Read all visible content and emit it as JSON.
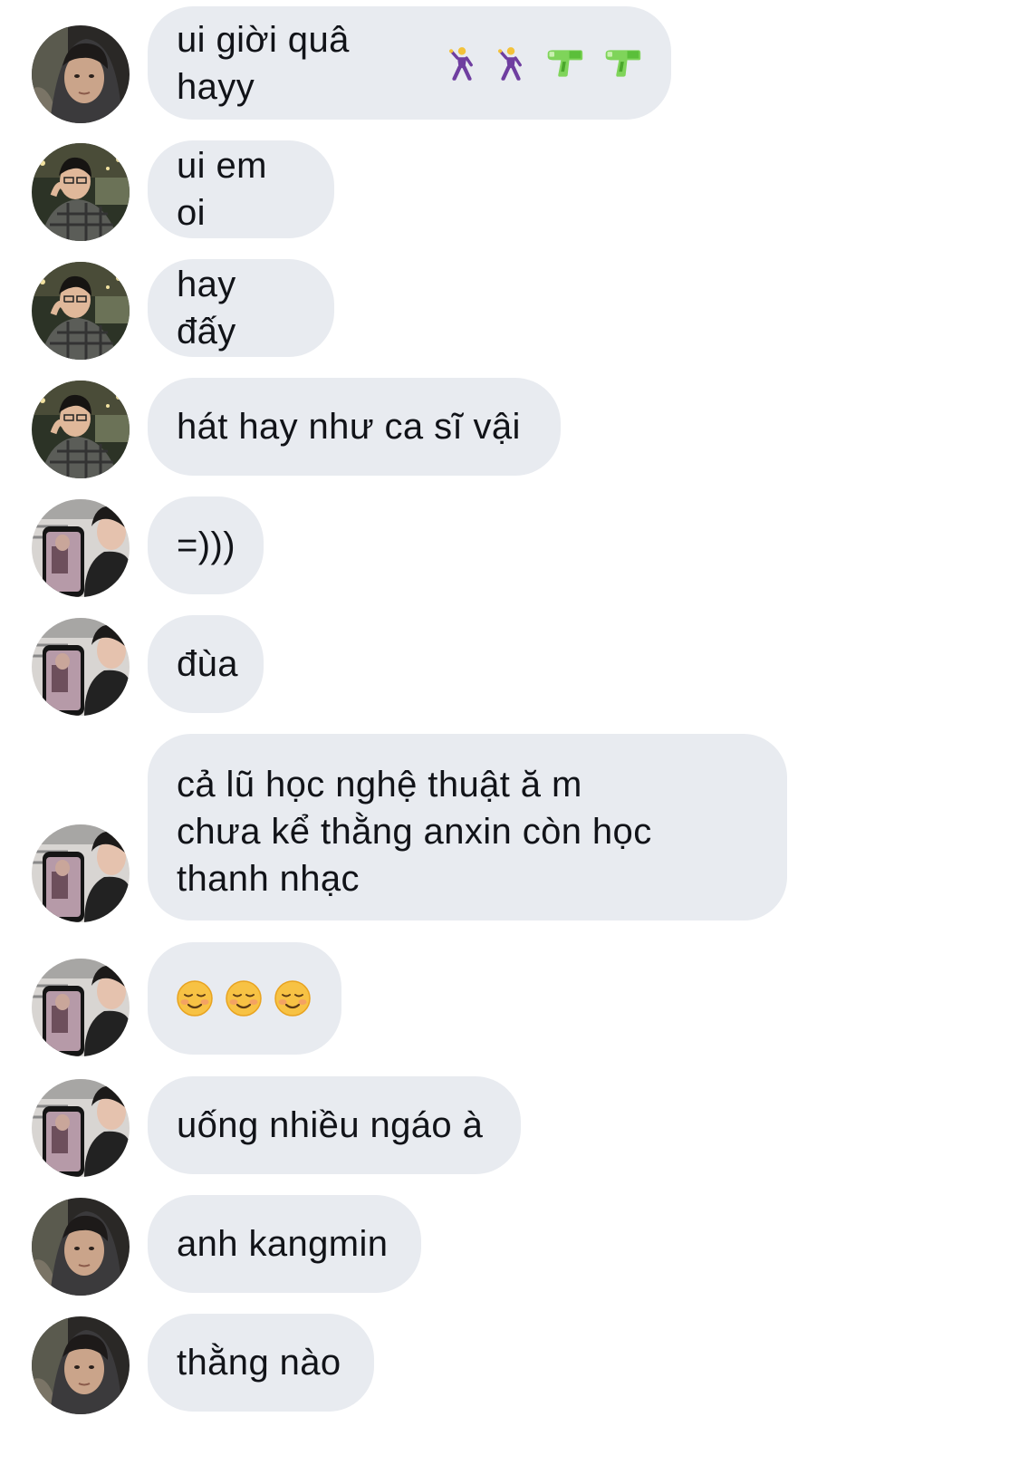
{
  "colors": {
    "bubble_bg": "#e8ebf0",
    "text": "#111318",
    "background": "#ffffff"
  },
  "messages": [
    {
      "sender": "avatar-a",
      "text": "ui giời quâ hayy",
      "emojis": [
        "dancer-icon",
        "dancer-icon",
        "water-pistol-icon",
        "water-pistol-icon"
      ]
    },
    {
      "sender": "avatar-b",
      "text": "ui em oi"
    },
    {
      "sender": "avatar-b",
      "text": "hay đấy"
    },
    {
      "sender": "avatar-b",
      "text": "hát hay như ca sĩ vậi"
    },
    {
      "sender": "avatar-c",
      "text": "=)))"
    },
    {
      "sender": "avatar-c",
      "text": "đùa"
    },
    {
      "sender": "avatar-c",
      "text": "cả lũ học nghệ thuật ă m\nchưa kể thằng anxin còn học\nthanh nhạc"
    },
    {
      "sender": "avatar-c",
      "text": "",
      "emojis": [
        "smiling-face-icon",
        "smiling-face-icon",
        "smiling-face-icon"
      ]
    },
    {
      "sender": "avatar-c",
      "text": "uống nhiều ngáo à"
    },
    {
      "sender": "avatar-a",
      "text": "anh kangmin"
    },
    {
      "sender": "avatar-a",
      "text": "thằng nào"
    }
  ]
}
